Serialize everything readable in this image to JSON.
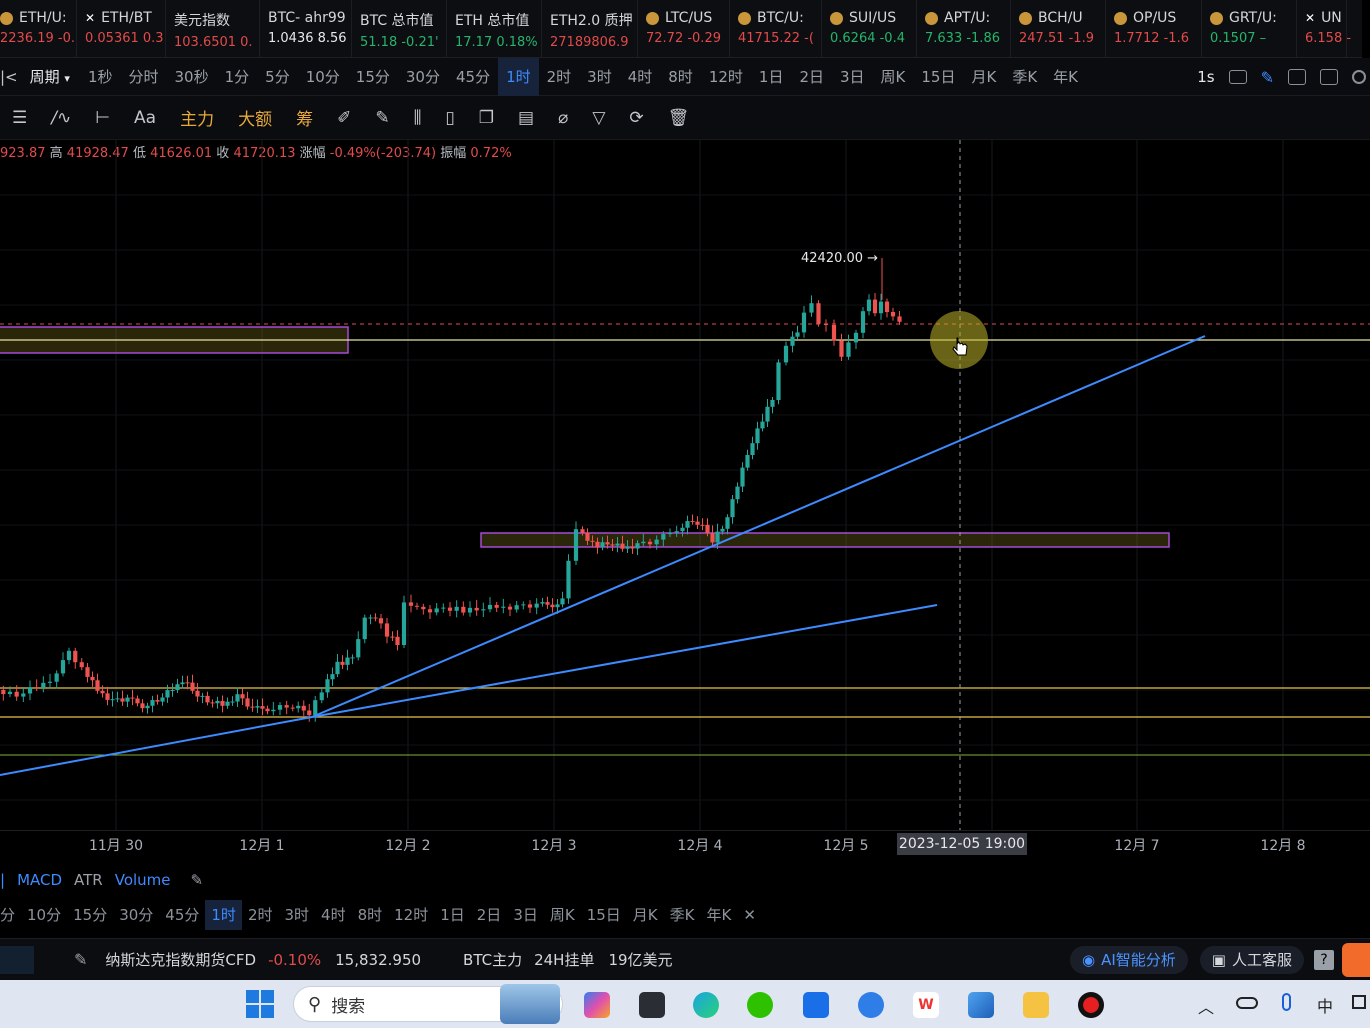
{
  "ticker": [
    {
      "name": "ETH/U:",
      "value": "2236.19 -0.",
      "icon": "coin-icon",
      "up": false
    },
    {
      "name": "ETH/BT",
      "value": "0.05361 0.3",
      "icon": "x-icon",
      "up": false
    },
    {
      "name": "美元指数",
      "value": "103.6501 0.",
      "icon": "",
      "up": false
    },
    {
      "name": "BTC- ahr99",
      "value": "1.0436 8.56",
      "icon": "",
      "up": null
    },
    {
      "name": "BTC 总市值",
      "value": "51.18 -0.21'",
      "icon": "",
      "up": true
    },
    {
      "name": "ETH 总市值",
      "value": "17.17 0.18%",
      "icon": "",
      "up": true
    },
    {
      "name": "ETH2.0 质押",
      "value": "27189806.9",
      "icon": "",
      "up": false
    },
    {
      "name": "LTC/US",
      "value": "72.72 -0.29",
      "icon": "coin-icon",
      "up": false
    },
    {
      "name": "BTC/U:",
      "value": "41715.22 -(",
      "icon": "coin-icon",
      "up": false
    },
    {
      "name": "SUI/US",
      "value": "0.6264 -0.4",
      "icon": "coin-icon",
      "up": true
    },
    {
      "name": "APT/U:",
      "value": "7.633 -1.86",
      "icon": "coin-icon",
      "up": true
    },
    {
      "name": "BCH/U",
      "value": "247.51 -1.9",
      "icon": "coin-icon",
      "up": false
    },
    {
      "name": "OP/US",
      "value": "1.7712 -1.6",
      "icon": "coin-icon",
      "up": false
    },
    {
      "name": "GRT/U:",
      "value": "0.1507 –",
      "icon": "coin-icon",
      "up": true
    },
    {
      "name": "UN",
      "value": "6.158 -",
      "icon": "x-icon",
      "up": false
    }
  ],
  "periods": {
    "cycle_label": "周期",
    "items": [
      "1秒",
      "分时",
      "30秒",
      "1分",
      "5分",
      "10分",
      "15分",
      "30分",
      "45分",
      "1时",
      "2时",
      "3时",
      "4时",
      "8时",
      "12时",
      "1日",
      "2日",
      "3日",
      "周K",
      "15日",
      "月K",
      "季K",
      "年K"
    ],
    "active": "1时",
    "speed": "1s"
  },
  "tools": {
    "font_label": "Aa",
    "main_force": "主力",
    "large_order": "大额",
    "chips": "筹"
  },
  "ohlc": {
    "open_partial": "923.87",
    "high_label": "高",
    "high": "41928.47",
    "low_label": "低",
    "low": "41626.01",
    "close_label": "收",
    "close": "41720.13",
    "change_label": "涨幅",
    "change": "-0.49%(-203.74)",
    "amp_label": "振幅",
    "amp": "0.72%"
  },
  "chart": {
    "max_label": "42420.00 →",
    "colors": {
      "up": "#26a69a",
      "down": "#ef5350",
      "trend": "#3d8bff",
      "zone": "#a64bd8",
      "hline_yellow": "#e8c14a",
      "hline_green": "#7fb539"
    }
  },
  "xaxis": {
    "labels": [
      "11月 30",
      "12月 1",
      "12月 2",
      "12月 3",
      "12月 4",
      "12月 5",
      "12月 7",
      "12月 8"
    ],
    "crosshair_label": "2023-12-05 19:00"
  },
  "indicators": {
    "items": [
      "MACD",
      "ATR",
      "Volume"
    ]
  },
  "periods2": {
    "items": [
      "分",
      "10分",
      "15分",
      "30分",
      "45分",
      "1时",
      "2时",
      "3时",
      "4时",
      "8时",
      "12时",
      "1日",
      "2日",
      "3日",
      "周K",
      "15日",
      "月K",
      "季K",
      "年K"
    ],
    "active": "1时"
  },
  "bottom": {
    "instrument": "纳斯达克指数期货CFD",
    "change": "-0.10%",
    "price": "15,832.950",
    "btc_main": "BTC主力",
    "orders": "24H挂单",
    "amount": "19亿美元",
    "ai_label": "AI智能分析",
    "service_label": "人工客服"
  },
  "taskbar": {
    "search_placeholder": "搜索",
    "tray_lang": "中"
  }
}
